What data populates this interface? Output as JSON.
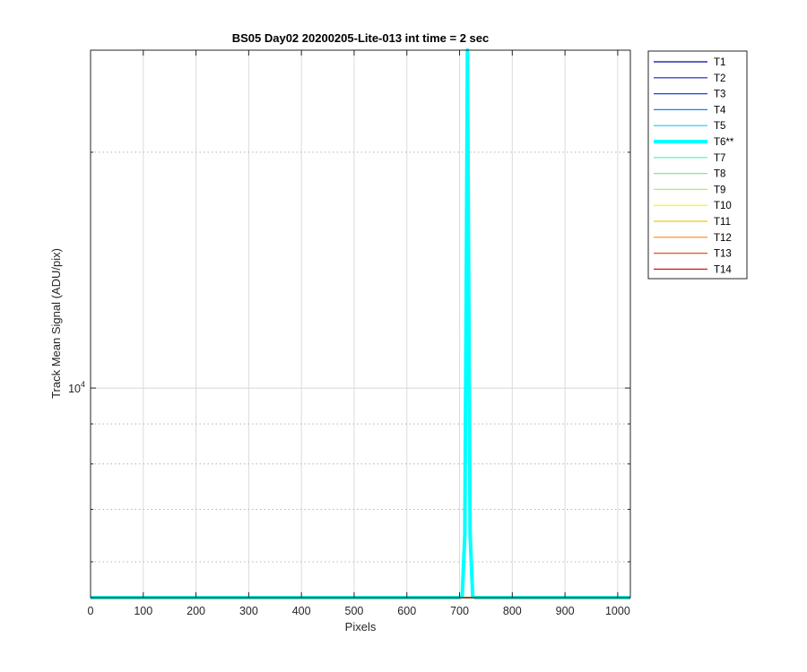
{
  "chart_data": {
    "type": "line",
    "title": "BS05 Day02 20200205-Lite-013 int time = 2 sec",
    "xlabel": "Pixels",
    "ylabel": "Track Mean Signal (ADU/pix)",
    "xlim": [
      0,
      1024
    ],
    "ylim": [
      5400,
      27000
    ],
    "yscale": "log",
    "x_ticks": [
      0,
      100,
      200,
      300,
      400,
      500,
      600,
      700,
      800,
      900,
      1000
    ],
    "y_major_ticks": [
      10000
    ],
    "y_major_tick_labels": [
      {
        "base": "10",
        "exp": "4"
      }
    ],
    "y_minor_ticks": [
      6000,
      7000,
      8000,
      9000,
      20000
    ],
    "grid": true,
    "legend_position": "outside-right",
    "series": [
      {
        "name": "T1",
        "color": "#0000aa",
        "width": 1.2,
        "x": [
          0,
          1024
        ],
        "y": [
          5400,
          5400
        ]
      },
      {
        "name": "T2",
        "color": "#0a23c8",
        "width": 1.2,
        "x": [
          0,
          1024
        ],
        "y": [
          5400,
          5400
        ]
      },
      {
        "name": "T3",
        "color": "#1446e6",
        "width": 1.2,
        "x": [
          0,
          1024
        ],
        "y": [
          5400,
          5400
        ]
      },
      {
        "name": "T4",
        "color": "#1e82e6",
        "width": 1.2,
        "x": [
          0,
          1024
        ],
        "y": [
          5400,
          5400
        ]
      },
      {
        "name": "T5",
        "color": "#1ec8f0",
        "width": 1.2,
        "x": [
          0,
          1024
        ],
        "y": [
          5400,
          5400
        ]
      },
      {
        "name": "T6**",
        "color": "#00ffff",
        "width": 4,
        "x": [
          0,
          700,
          705,
          710,
          713,
          715,
          717,
          720,
          725,
          730,
          1024
        ],
        "y": [
          5400,
          5400,
          5420,
          6500,
          15000,
          27000,
          15000,
          6500,
          5420,
          5400,
          5400
        ]
      },
      {
        "name": "T7",
        "color": "#46f0c8",
        "width": 1.2,
        "x": [
          0,
          1024
        ],
        "y": [
          5400,
          5400
        ]
      },
      {
        "name": "T8",
        "color": "#78f08c",
        "width": 1.2,
        "x": [
          0,
          1024
        ],
        "y": [
          5400,
          5400
        ]
      },
      {
        "name": "T9",
        "color": "#b4f050",
        "width": 1.2,
        "x": [
          0,
          1024
        ],
        "y": [
          5400,
          5400
        ]
      },
      {
        "name": "T10",
        "color": "#f0f014",
        "width": 1.2,
        "x": [
          0,
          1024
        ],
        "y": [
          5400,
          5400
        ]
      },
      {
        "name": "T11",
        "color": "#f0c814",
        "width": 1.2,
        "x": [
          0,
          1024
        ],
        "y": [
          5400,
          5400
        ]
      },
      {
        "name": "T12",
        "color": "#f08c14",
        "width": 1.2,
        "x": [
          0,
          1024
        ],
        "y": [
          5400,
          5400
        ]
      },
      {
        "name": "T13",
        "color": "#f05014",
        "width": 1.2,
        "x": [
          0,
          1024
        ],
        "y": [
          5400,
          5400
        ]
      },
      {
        "name": "T14",
        "color": "#dc1414",
        "width": 1.2,
        "x": [
          0,
          1024
        ],
        "y": [
          5400,
          5400
        ]
      }
    ]
  }
}
